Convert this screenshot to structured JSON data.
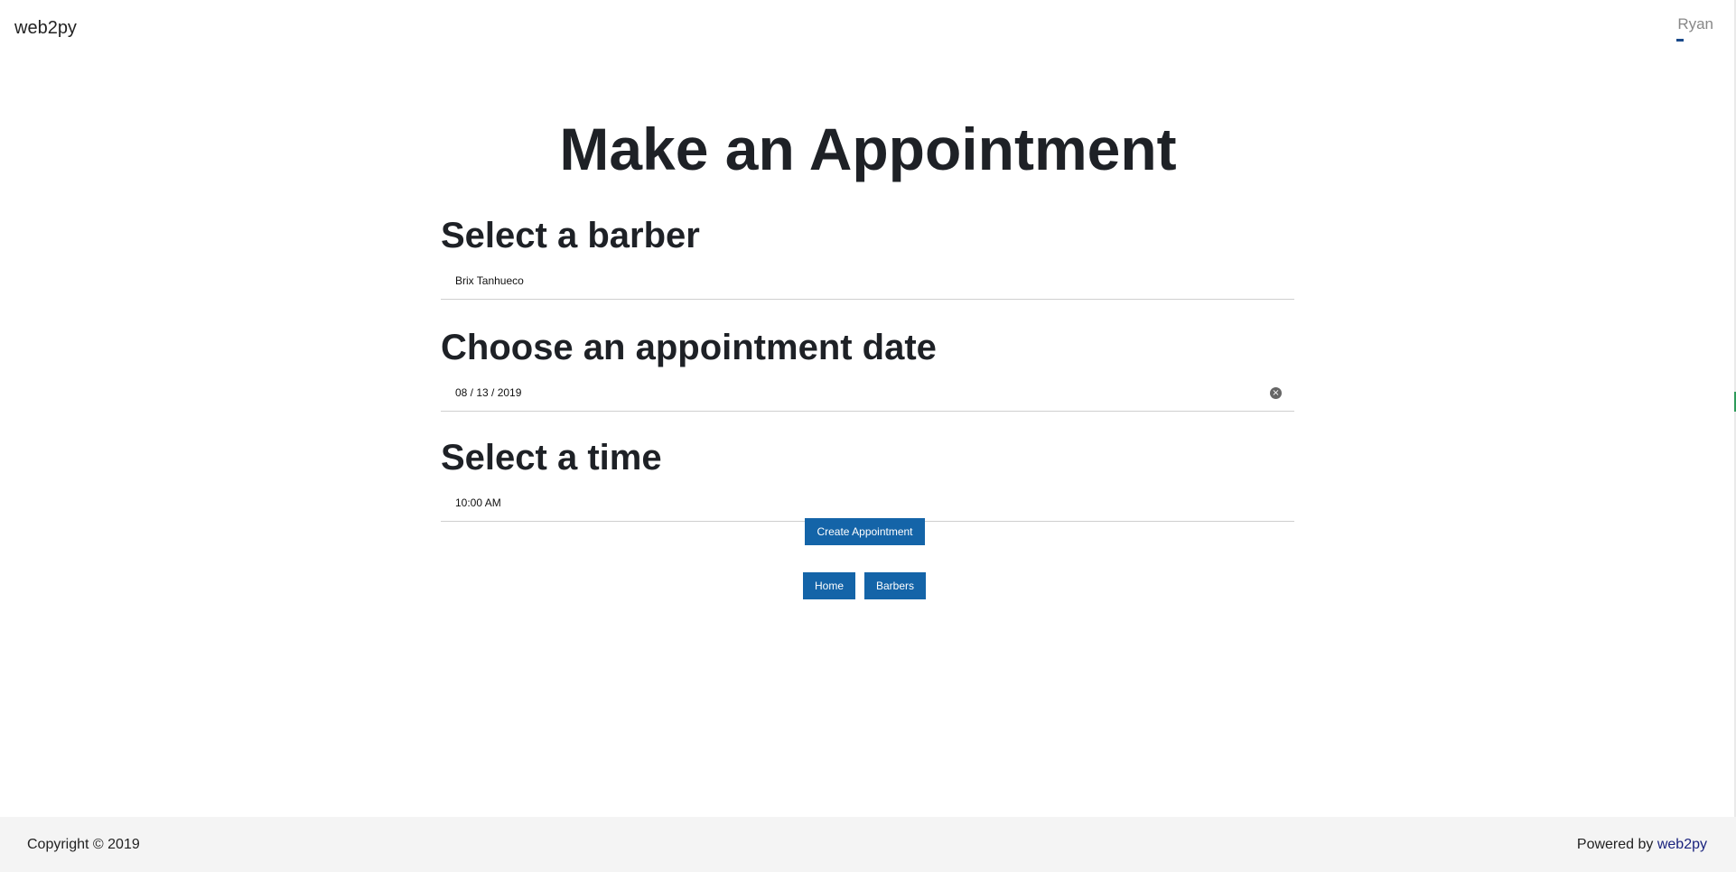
{
  "navbar": {
    "brand": "web2py",
    "user": "Ryan"
  },
  "page": {
    "title": "Make an Appointment"
  },
  "form": {
    "barber": {
      "heading": "Select a barber",
      "value": "Brix Tanhueco"
    },
    "date": {
      "heading": "Choose an appointment date",
      "value": "08 / 13 / 2019",
      "clear_icon": "clear-circle-icon"
    },
    "time": {
      "heading": "Select a time",
      "value": "10:00 AM"
    },
    "submit_label": "Create Appointment"
  },
  "nav_buttons": {
    "home_label": "Home",
    "barbers_label": "Barbers"
  },
  "footer": {
    "copyright": "Copyright © 2019",
    "powered_prefix": "Powered by",
    "powered_link": "web2py"
  },
  "colors": {
    "accent": "#1464a8",
    "footer_bg": "#f4f4f4",
    "link": "#1a237e"
  }
}
